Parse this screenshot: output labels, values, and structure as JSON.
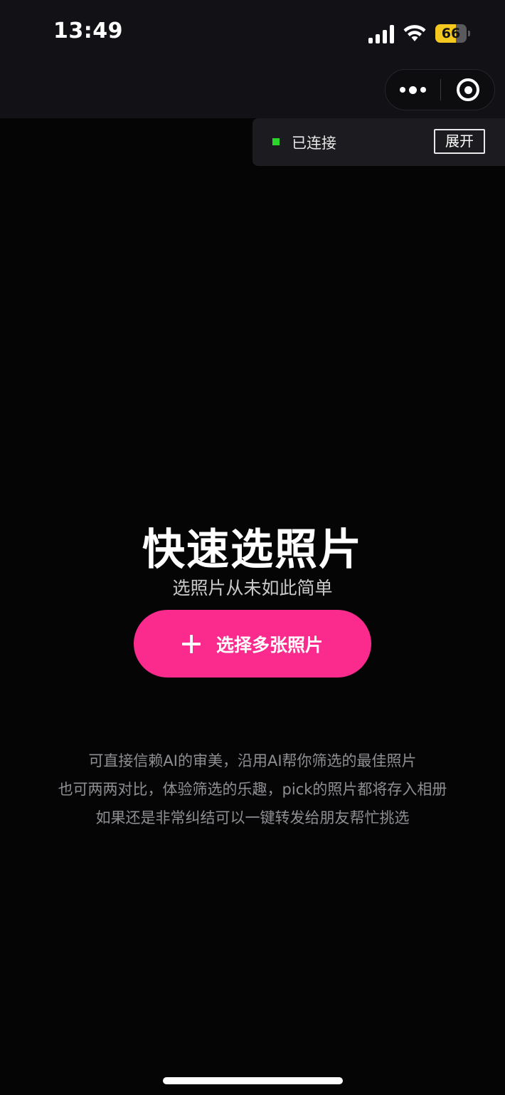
{
  "status_bar": {
    "time": "13:49",
    "battery_level": "66",
    "icons": [
      "signal-icon",
      "wifi-icon",
      "battery-icon"
    ]
  },
  "capsule": {
    "icons": [
      "more-dots-icon",
      "close-target-icon"
    ]
  },
  "connection": {
    "status": "已连接",
    "expand_label": "展开",
    "status_color": "#2bd62b"
  },
  "hero": {
    "title": "快速选照片",
    "subtitle": "选照片从未如此简单",
    "button_label": "选择多张照片",
    "button_color": "#fb2b8d"
  },
  "description": {
    "lines": [
      "可直接信赖AI的审美，沿用AI帮你筛选的最佳照片",
      "也可两两对比，体验筛选的乐趣，pick的照片都将存入相册",
      "如果还是非常纠结可以一键转发给朋友帮忙挑选"
    ]
  }
}
